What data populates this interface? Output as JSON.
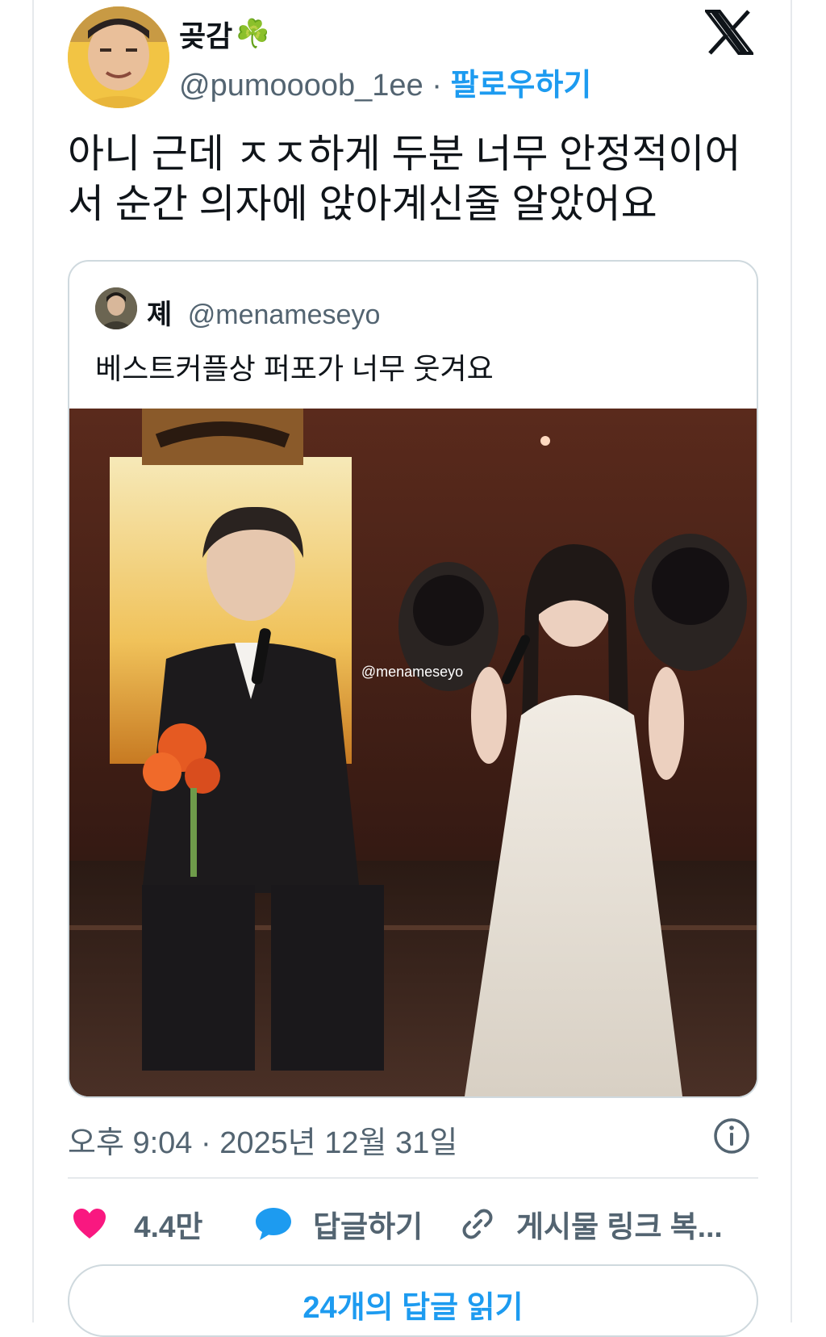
{
  "author": {
    "display_name": "곶감",
    "emoji": "☘️",
    "handle": "@pumoooob_1ee",
    "separator": "·",
    "follow_label": "팔로우하기"
  },
  "tweet": {
    "text": "아니 근데 ㅈㅈ하게 두분 너무 안정적이어서 순간 의자에 앉아계신줄 알았어요"
  },
  "quoted": {
    "display_name": "졔",
    "handle": "@menameseyo",
    "text": "베스트커플상 퍼포가 너무 웃겨요",
    "media_watermark": "@menameseyo"
  },
  "meta": {
    "time": "오후 9:04",
    "separator": "·",
    "date": "2025년 12월 31일"
  },
  "actions": {
    "likes": "4.4만",
    "reply_label": "답글하기",
    "copy_link_label": "게시물 링크 복..."
  },
  "replies_button": "24개의 답글 읽기",
  "colors": {
    "accent": "#1d9bf0",
    "like": "#f91880",
    "text": "#0f1419",
    "muted": "#536471"
  }
}
